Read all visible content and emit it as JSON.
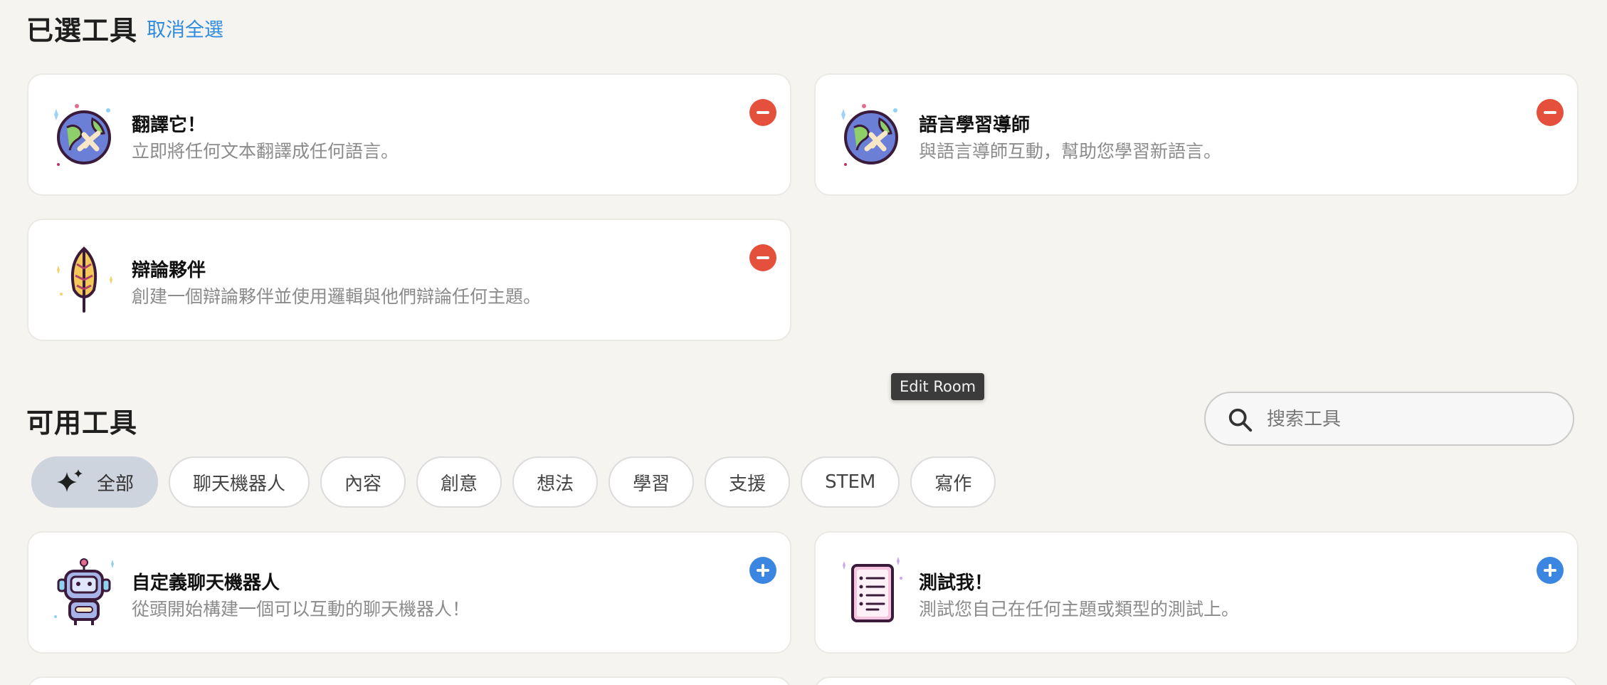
{
  "selected_section": {
    "title": "已選工具",
    "deselect_all": "取消全選",
    "cards": [
      {
        "title": "翻譯它！",
        "description": "立即將任何文本翻譯成任何語言。",
        "icon": "globe-plane-icon"
      },
      {
        "title": "語言學習導師",
        "description": "與語言導師互動，幫助您學習新語言。",
        "icon": "globe-plane-icon"
      },
      {
        "title": "辯論夥伴",
        "description": "創建一個辯論夥伴並使用邏輯與他們辯論任何主題。",
        "icon": "feather-icon"
      }
    ]
  },
  "tooltip": "Edit Room",
  "available_section": {
    "title": "可用工具",
    "search_placeholder": "搜索工具",
    "filters": [
      "全部",
      "聊天機器人",
      "內容",
      "創意",
      "想法",
      "學習",
      "支援",
      "STEM",
      "寫作"
    ],
    "active_filter": "全部",
    "cards": [
      {
        "title": "自定義聊天機器人",
        "description": "從頭開始構建一個可以互動的聊天機器人！",
        "icon": "robot-icon"
      },
      {
        "title": "測試我！",
        "description": "測試您自己在任何主題或類型的測試上。",
        "icon": "test-sheet-icon"
      }
    ]
  },
  "colors": {
    "accent_link": "#2f8be0",
    "remove_button": "#e4503b",
    "add_button": "#3a86e0",
    "background": "#f5f4f1"
  }
}
